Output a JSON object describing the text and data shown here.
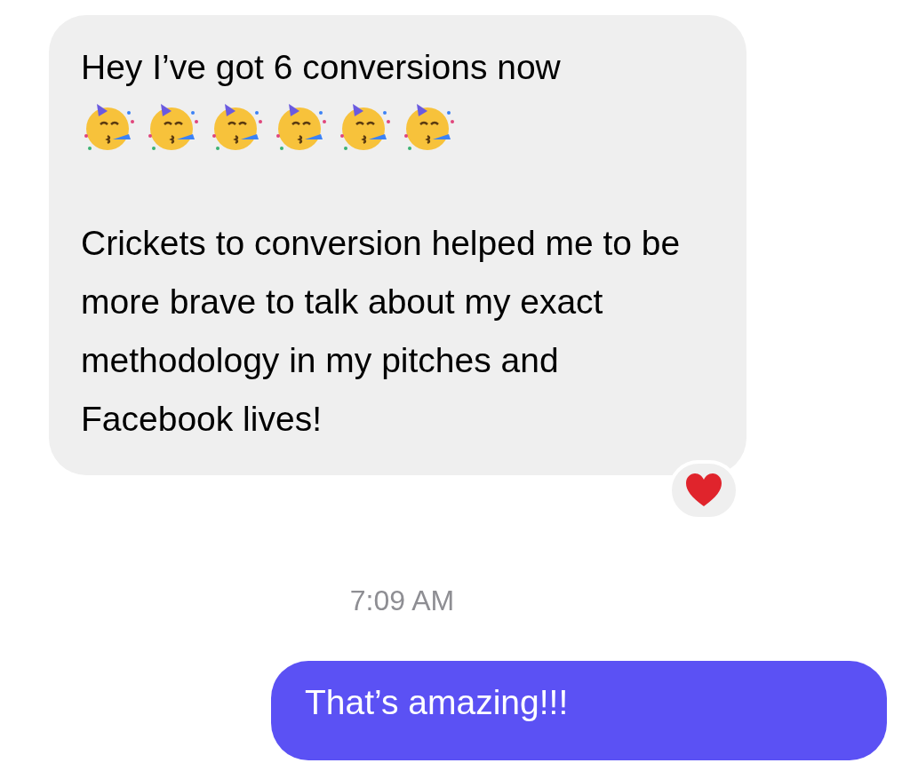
{
  "messages": [
    {
      "kind": "received",
      "first_line": "Hey I’ve got 6 conversions now",
      "emojis": [
        {
          "kind": "party-face"
        },
        {
          "kind": "party-face"
        },
        {
          "kind": "party-face"
        },
        {
          "kind": "party-face"
        },
        {
          "kind": "party-face"
        },
        {
          "kind": "party-face"
        }
      ],
      "body": "Crickets to conversion helped me to be more brave to talk about my exact methodology in my pitches and Facebook lives!",
      "reaction": {
        "kind": "heart"
      }
    },
    {
      "kind": "timestamp",
      "text": "7:09 AM"
    },
    {
      "kind": "sent",
      "text": "That’s amazing!!!"
    }
  ]
}
